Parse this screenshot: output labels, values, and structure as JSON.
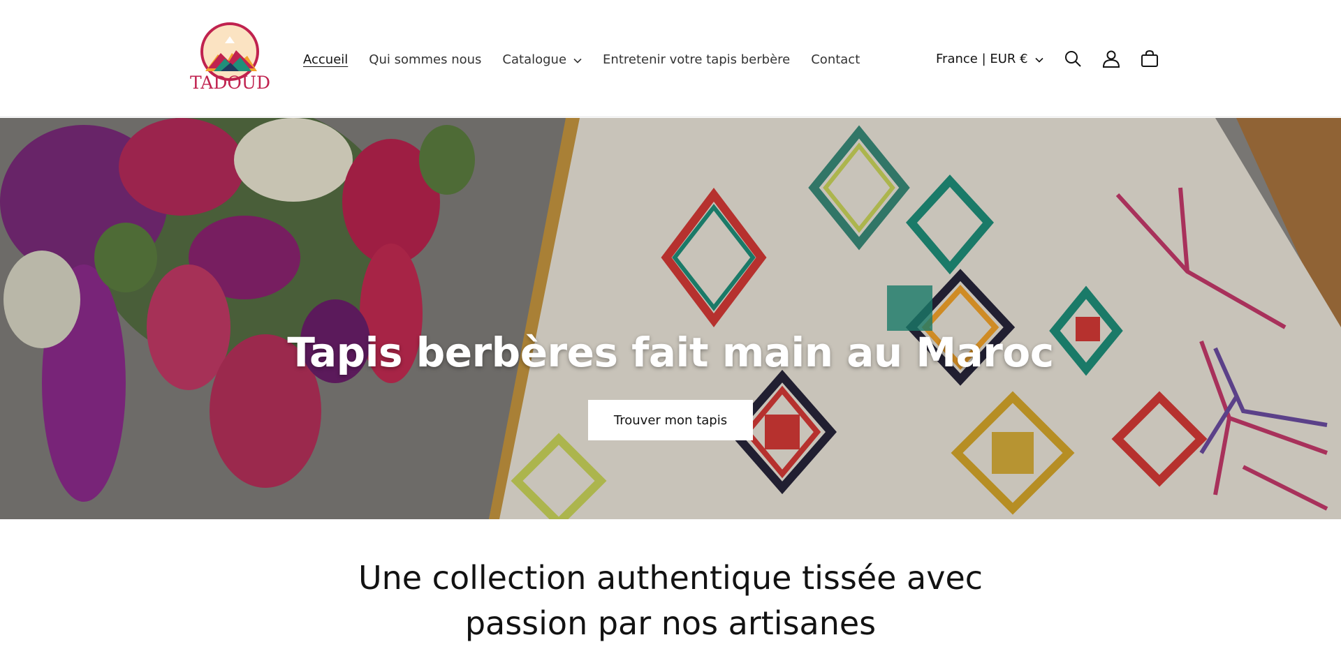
{
  "brand": {
    "name": "TADOUD"
  },
  "nav": {
    "items": [
      {
        "label": "Accueil",
        "active": true
      },
      {
        "label": "Qui sommes nous"
      },
      {
        "label": "Catalogue",
        "has_dropdown": true
      },
      {
        "label": "Entretenir votre tapis berbère"
      },
      {
        "label": "Contact"
      }
    ]
  },
  "header": {
    "currency_selector": "France | EUR €",
    "icons": [
      "search-icon",
      "account-icon",
      "cart-icon"
    ]
  },
  "hero": {
    "title": "Tapis berbères fait main au Maroc",
    "button_label": "Trouver mon tapis"
  },
  "intro": {
    "line1": "Une collection authentique tissée avec",
    "line2": "passion par nos artisanes"
  },
  "colors": {
    "brand_red": "#c0224f",
    "text": "#121212",
    "background": "#ffffff"
  }
}
